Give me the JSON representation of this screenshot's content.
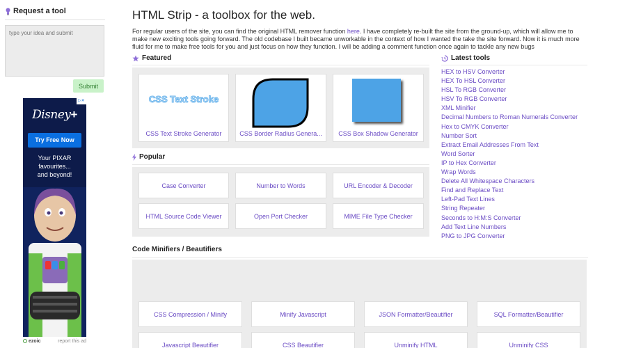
{
  "sidebar": {
    "request_title": "Request a tool",
    "idea_placeholder": "type your idea and submit",
    "submit_label": "Submit"
  },
  "ad": {
    "brand": "Disney",
    "brand_plus": "+",
    "cta": "Try Free Now",
    "copy_line1": "Your PIXAR",
    "copy_line2": "favourites...",
    "copy_line3": "and beyond!",
    "provider": "ezoic",
    "report": "report this ad"
  },
  "header": {
    "title": "HTML Strip - a toolbox for the web.",
    "intro_before_link": "For regular users of the site, you can find the original HTML remover function ",
    "intro_link": "here",
    "intro_after_link": ". I have completely re-built the site from the ground-up, which will allow me to make new exciting tools going forward. The old codebase I built became unworkable in the context of how I wanted the take the site forward. Now it is much more fluid for me to make free tools for you and just focus on how they function. I will be adding a comment function once again to tackle any new bugs"
  },
  "featured": {
    "title": "Featured",
    "items": [
      {
        "label": "CSS Text Stroke Generator",
        "preview_text": "CSS Text Stroke"
      },
      {
        "label": "CSS Border Radius Genera..."
      },
      {
        "label": "CSS Box Shadow Generator"
      }
    ]
  },
  "popular": {
    "title": "Popular",
    "items": [
      {
        "label": "Case Converter"
      },
      {
        "label": "Number to Words"
      },
      {
        "label": "URL Encoder & Decoder"
      },
      {
        "label": "HTML Source Code Viewer"
      },
      {
        "label": "Open Port Checker"
      },
      {
        "label": "MIME File Type Checker"
      }
    ]
  },
  "minifiers": {
    "title": "Code Minifiers / Beautifiers",
    "items": [
      {
        "label": "CSS Compression / Minify"
      },
      {
        "label": "Minify Javascript"
      },
      {
        "label": "JSON Formatter/Beautifier"
      },
      {
        "label": "SQL Formatter/Beautifier"
      },
      {
        "label": "Javascript Beautifier"
      },
      {
        "label": "CSS Beautifier"
      },
      {
        "label": "Unminify HTML"
      },
      {
        "label": "Unminify CSS"
      }
    ]
  },
  "latest": {
    "title": "Latest tools",
    "items": [
      "HEX to HSV Converter",
      "HEX To HSL Converter",
      "HSL To RGB Converter",
      "HSV To RGB Converter",
      "XML Minifier",
      "Decimal Numbers to Roman Numerals Converter",
      "Hex to CMYK Converter",
      "Number Sort",
      "Extract Email Addresses From Text",
      "Word Sorter",
      "IP to Hex Converter",
      "Wrap Words",
      "Delete All Whitespace Characters",
      "Find and Replace Text",
      "Left-Pad Text Lines",
      "String Repeater",
      "Seconds to H:M:S Converter",
      "Add Text Line Numbers",
      "PNG to JPG Converter"
    ]
  },
  "colors": {
    "link": "#6a4bc4",
    "panel": "#ececec",
    "submit_bg": "#c9f2c9",
    "accent_icon": "#8e6fd8",
    "ad_bg": "#0d1b4a",
    "ad_cta": "#0a6fe0"
  },
  "icons": [
    "lightbulb-icon",
    "star-icon",
    "bolt-icon",
    "history-icon",
    "adchoices-icon"
  ]
}
